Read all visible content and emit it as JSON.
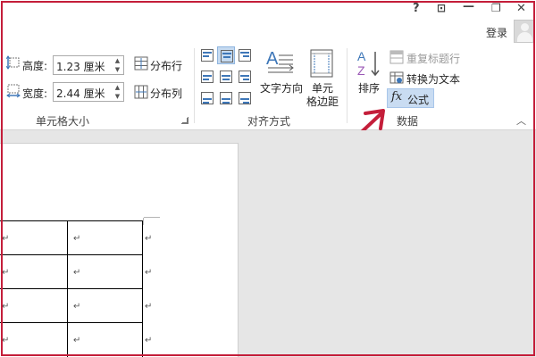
{
  "window": {
    "help": "?",
    "ribbon_display": "⊡",
    "minimize": "—",
    "restore": "❐",
    "close": "✕",
    "signin": "登录"
  },
  "cell_size": {
    "height_label": "高度:",
    "height_value": "1.23 厘米",
    "width_label": "宽度:",
    "width_value": "2.44 厘米",
    "distribute_rows": "分布行",
    "distribute_columns": "分布列",
    "group_label": "单元格大小"
  },
  "alignment": {
    "text_direction": "文字方向",
    "cell_margins_line1": "单元",
    "cell_margins_line2": "格边距",
    "group_label": "对齐方式"
  },
  "data": {
    "sort": "排序",
    "repeat_header_rows": "重复标题行",
    "convert_to_text": "转换为文本",
    "formula": "公式",
    "group_label": "数据"
  },
  "document": {
    "cell_mark": "↵"
  },
  "colors": {
    "annotation_red": "#c41e3a",
    "selected_blue": "#c9dcf2",
    "accent_blue": "#3e77b8"
  }
}
